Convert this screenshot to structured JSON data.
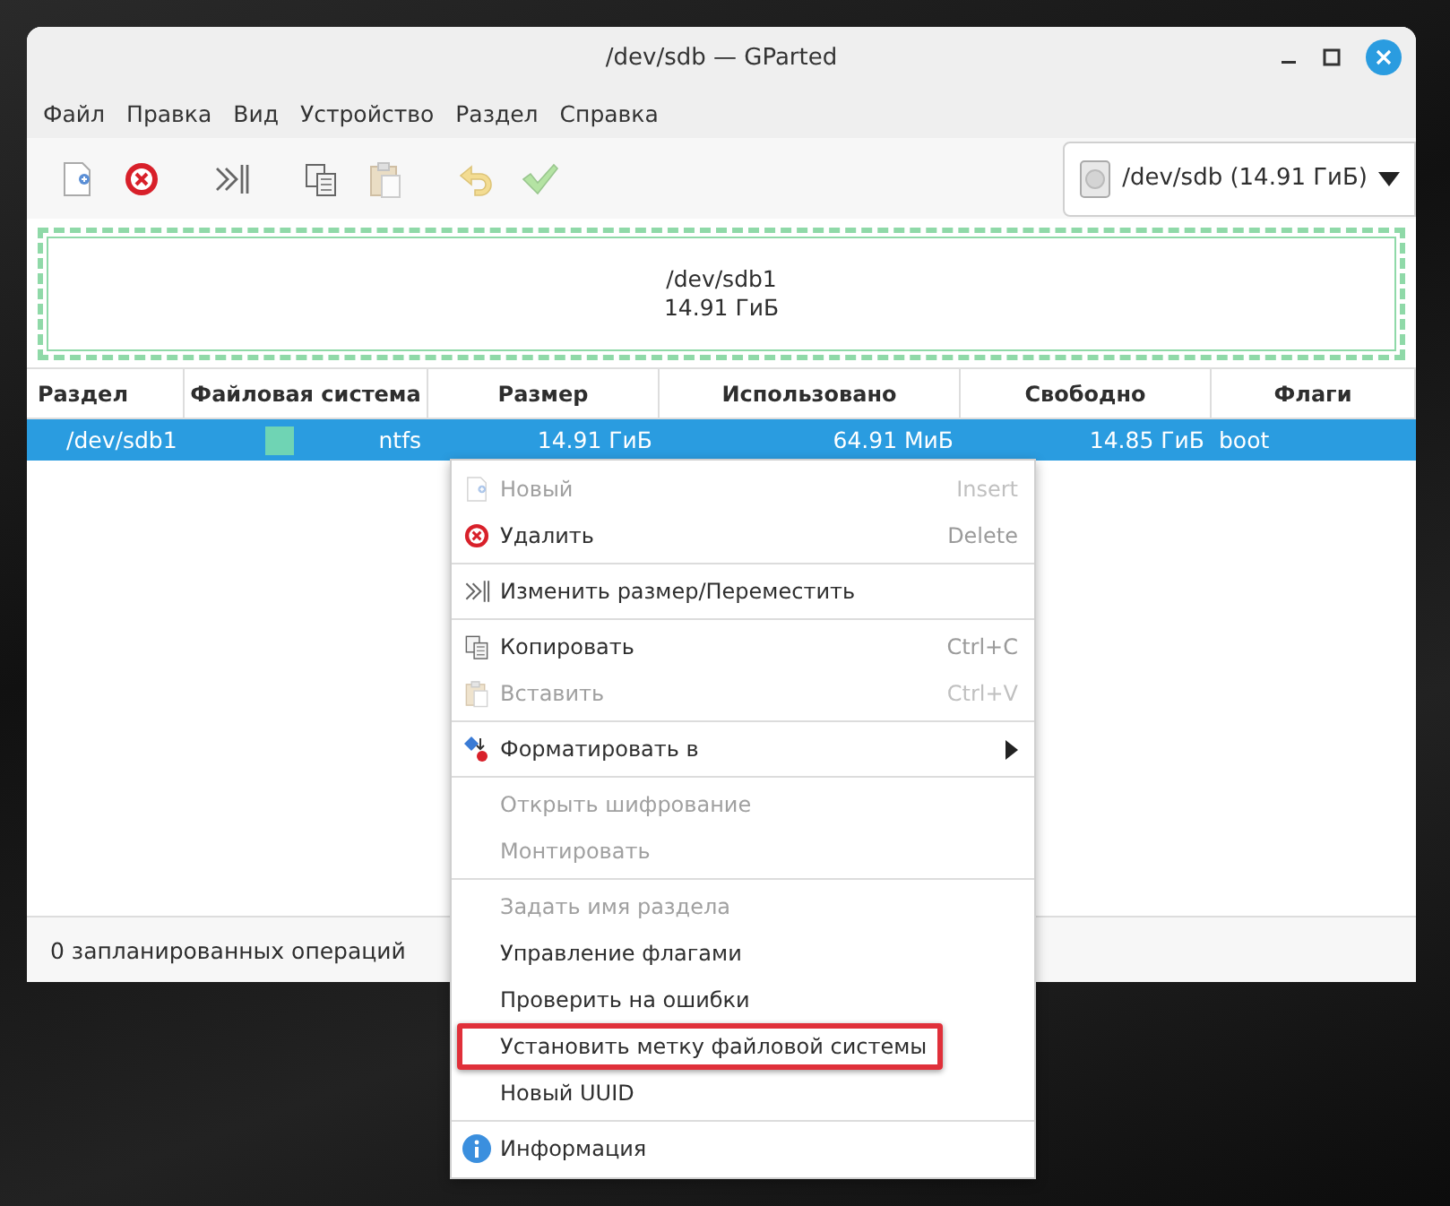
{
  "window": {
    "title": "/dev/sdb — GParted"
  },
  "menu_bar": [
    "Файл",
    "Правка",
    "Вид",
    "Устройство",
    "Раздел",
    "Справка"
  ],
  "toolbar": [
    {
      "kind": "new",
      "disabled": false
    },
    {
      "kind": "delete",
      "disabled": false
    },
    {
      "kind": "resize",
      "disabled": false
    },
    {
      "kind": "copy",
      "disabled": false
    },
    {
      "kind": "paste",
      "disabled": true
    },
    {
      "kind": "undo",
      "disabled": true
    },
    {
      "kind": "apply",
      "disabled": true
    }
  ],
  "device_selector": {
    "value": "/dev/sdb (14.91 ГиБ)"
  },
  "partition_graph": {
    "name": "/dev/sdb1",
    "size": "14.91 ГиБ",
    "selected": true
  },
  "table": {
    "columns": [
      "Раздел",
      "Файловая система",
      "Размер",
      "Использовано",
      "Свободно",
      "Флаги"
    ],
    "rows": [
      {
        "partition": "/dev/sdb1",
        "filesystem": "ntfs",
        "color": "#6fd4b4",
        "size": "14.91 ГиБ",
        "used": "64.91 МиБ",
        "free": "14.85 ГиБ",
        "flags": "boot",
        "selected": true
      }
    ]
  },
  "status_bar": "0 запланированных операций",
  "context_menu": [
    {
      "kind": "new",
      "label": "Новый",
      "shortcut": "Insert",
      "disabled": true
    },
    {
      "kind": "delete",
      "label": "Удалить",
      "shortcut": "Delete",
      "disabled": false
    },
    {
      "kind": "separator"
    },
    {
      "kind": "resize",
      "label": "Изменить размер/Переместить",
      "disabled": false
    },
    {
      "kind": "separator"
    },
    {
      "kind": "copy",
      "label": "Копировать",
      "shortcut": "Ctrl+C",
      "disabled": false
    },
    {
      "kind": "paste",
      "label": "Вставить",
      "shortcut": "Ctrl+V",
      "disabled": true
    },
    {
      "kind": "separator"
    },
    {
      "kind": "format",
      "label": "Форматировать в",
      "submenu": true,
      "disabled": false
    },
    {
      "kind": "separator"
    },
    {
      "kind": "plain",
      "label": "Открыть шифрование",
      "disabled": true
    },
    {
      "kind": "plain",
      "label": "Монтировать",
      "disabled": true
    },
    {
      "kind": "separator"
    },
    {
      "kind": "plain",
      "label": "Задать имя раздела",
      "disabled": true
    },
    {
      "kind": "plain",
      "label": "Управление флагами",
      "disabled": false
    },
    {
      "kind": "plain",
      "label": "Проверить на ошибки",
      "disabled": false
    },
    {
      "kind": "plain",
      "label": "Установить метку файловой системы",
      "disabled": false,
      "highlighted": true
    },
    {
      "kind": "plain",
      "label": "Новый UUID",
      "disabled": false
    },
    {
      "kind": "separator"
    },
    {
      "kind": "info",
      "label": "Информация",
      "disabled": false
    }
  ]
}
